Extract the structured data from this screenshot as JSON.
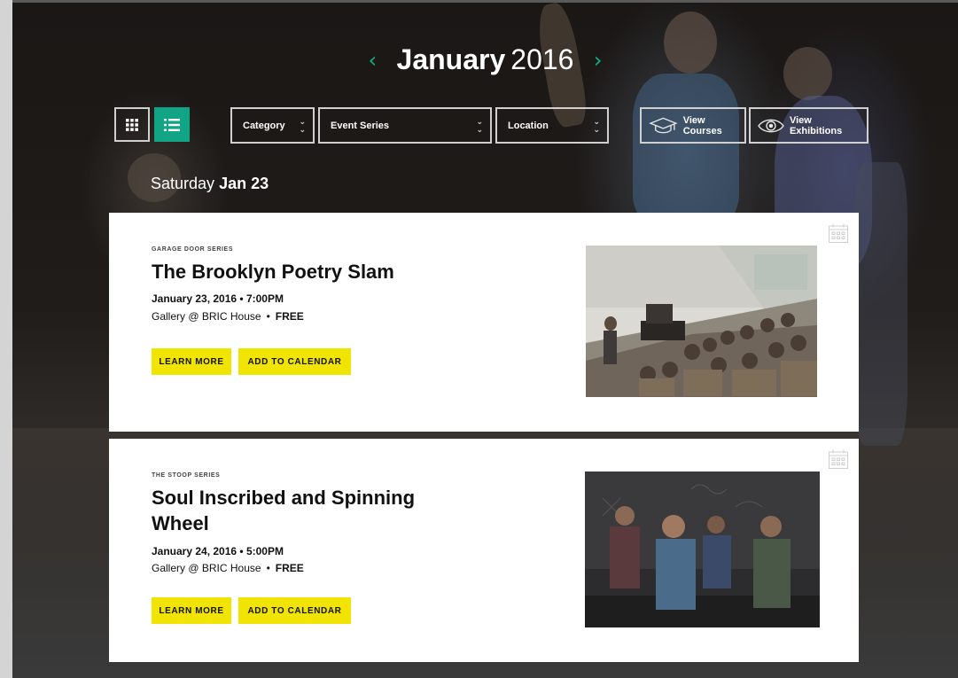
{
  "header": {
    "month": "January",
    "year": "2016",
    "prev_icon": "chevron-left-icon",
    "next_icon": "chevron-right-icon"
  },
  "toolbar": {
    "grid_view_icon": "grid-icon",
    "list_view_icon": "list-icon",
    "active_view": "list",
    "filters": [
      {
        "label": "Category"
      },
      {
        "label": "Event Series"
      },
      {
        "label": "Location"
      }
    ],
    "view_courses_label": "View Courses",
    "view_exhibitions_label": "View Exhibitions"
  },
  "day": {
    "weekday": "Saturday",
    "date": "Jan 23"
  },
  "events": [
    {
      "series": "GARAGE DOOR SERIES",
      "title": "The Brooklyn Poetry Slam",
      "datetime": "January 23, 2016 • 7:00PM",
      "venue": "Gallery @ BRIC House",
      "price": "FREE",
      "learn_more": "LEARN MORE",
      "add_calendar": "ADD TO CALENDAR"
    },
    {
      "series": "THE STOOP SERIES",
      "title": "Soul Inscribed and Spinning Wheel",
      "datetime": "January 24, 2016 • 5:00PM",
      "venue": "Gallery @ BRIC House",
      "price": "FREE",
      "learn_more": "LEARN MORE",
      "add_calendar": "ADD TO CALENDAR"
    }
  ],
  "colors": {
    "accent": "#12a585",
    "button_yellow": "#f1e400"
  }
}
